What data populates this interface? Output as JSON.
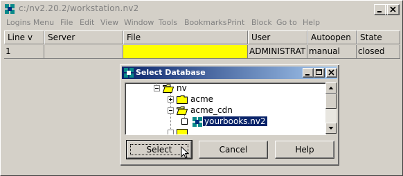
{
  "window": {
    "title": "c:/nv2.20.2/workstation.nv2"
  },
  "menu": [
    "Logins Menu",
    "File",
    "Edit",
    "View",
    "Window",
    "Tools",
    "Bookmarks",
    "Print",
    "Block",
    "Go to",
    "Help"
  ],
  "table": {
    "headers": [
      "Line  v",
      "Server",
      "File",
      "User",
      "Autoopen",
      "State"
    ],
    "rows": [
      [
        "1",
        "",
        "",
        "ADMINISTRAT",
        "manual",
        "closed"
      ]
    ],
    "highlight_color": "#ffff00"
  },
  "dialog": {
    "title": "Select Database",
    "tree": [
      {
        "label": "nv",
        "icon": "open-folder-icon",
        "expander": "minus"
      },
      {
        "label": "acme",
        "icon": "folder-icon",
        "expander": "plus"
      },
      {
        "label": "acme_cdn",
        "icon": "open-folder-icon",
        "expander": "minus"
      },
      {
        "label": "yourbooks.nv2",
        "icon": "database-icon",
        "selected": true
      }
    ],
    "buttons": {
      "select": "Select",
      "cancel": "Cancel",
      "help": "Help"
    }
  },
  "colors": {
    "dialog_title_start": "#0a246a",
    "dialog_title_end": "#a6caf0",
    "selection": "#0a246a"
  }
}
